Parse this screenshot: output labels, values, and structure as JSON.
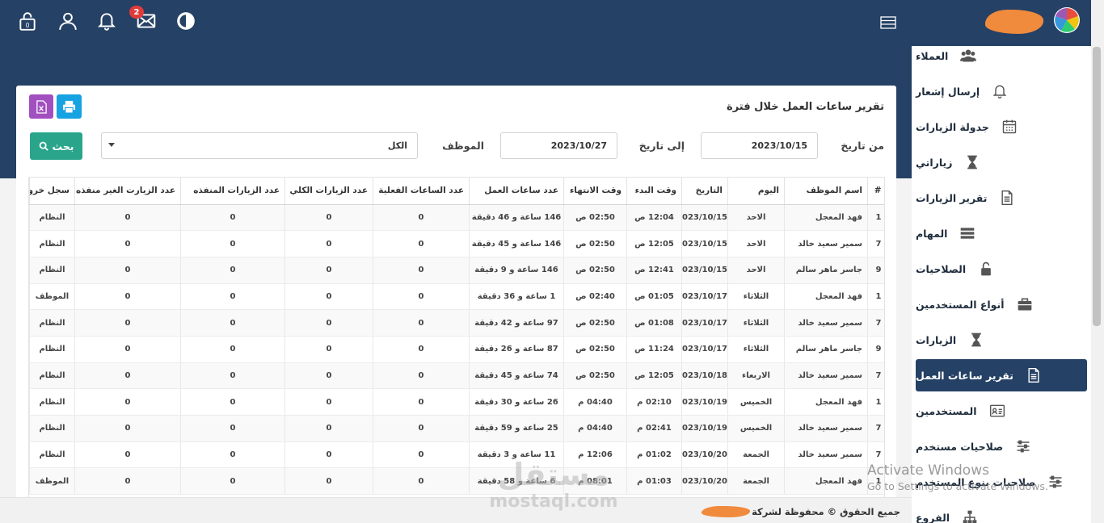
{
  "header": {
    "notification_count": "2"
  },
  "sidebar": {
    "items": [
      {
        "label": "العملاء",
        "icon": "users-icon"
      },
      {
        "label": "إرسال إشعار",
        "icon": "bell-icon"
      },
      {
        "label": "جدولة الزيارات",
        "icon": "calendar-icon"
      },
      {
        "label": "زياراتي",
        "icon": "hourglass-icon"
      },
      {
        "label": "تقرير الزيارات",
        "icon": "document-icon"
      },
      {
        "label": "المهام",
        "icon": "tasks-icon"
      },
      {
        "label": "الصلاحيات",
        "icon": "unlock-icon"
      },
      {
        "label": "أنواع المستخدمين",
        "icon": "briefcase-icon"
      },
      {
        "label": "الزيارات",
        "icon": "hourglass-icon"
      },
      {
        "label": "تقرير ساعات العمل",
        "icon": "document-icon"
      },
      {
        "label": "المستخدمين",
        "icon": "id-card-icon"
      },
      {
        "label": "صلاحيات مستخدم",
        "icon": "sliders-icon"
      },
      {
        "label": "صلاحيات بنوع المستخدم",
        "icon": "sliders-icon"
      },
      {
        "label": "الفروع",
        "icon": "sitemap-icon"
      }
    ],
    "active_index": 9
  },
  "report": {
    "title": "تقرير ساعات العمل خلال فترة",
    "from_label": "من تاريخ",
    "from_value": "2023/10/15",
    "to_label": "إلى تاريخ",
    "to_value": "2023/10/27",
    "employee_label": "الموظف",
    "employee_value": "الكل",
    "search_label": "بحث"
  },
  "table": {
    "headers": [
      "#",
      "اسم الموظف",
      "اليوم",
      "التاريخ",
      "وقت البدء",
      "وقت الانتهاء",
      "عدد ساعات العمل",
      "عدد الساعات الفعلية",
      "عدد الزيارات الكلي",
      "عدد الزيارات المنفذه",
      "عدد الزيارت الغير منفذه",
      "سجل خروج"
    ],
    "rows": [
      [
        "1",
        "فهد المعجل",
        "الاحد",
        "2023/10/15",
        "12:04 ص",
        "02:50 ص",
        "146 ساعة و 46 دقيقة",
        "0",
        "0",
        "0",
        "0",
        "النظام"
      ],
      [
        "7",
        "سمير سعيد خالد",
        "الاحد",
        "2023/10/15",
        "12:05 ص",
        "02:50 ص",
        "146 ساعة و 45 دقيقة",
        "0",
        "0",
        "0",
        "0",
        "النظام"
      ],
      [
        "9",
        "جاسر ماهر سالم",
        "الاحد",
        "2023/10/15",
        "12:41 ص",
        "02:50 ص",
        "146 ساعة و 9 دقيقة",
        "0",
        "0",
        "0",
        "0",
        "النظام"
      ],
      [
        "1",
        "فهد المعجل",
        "الثلاثاء",
        "2023/10/17",
        "01:05 ص",
        "02:40 ص",
        "1 ساعة و 36 دقيقة",
        "0",
        "0",
        "0",
        "0",
        "الموظف"
      ],
      [
        "7",
        "سمير سعيد خالد",
        "الثلاثاء",
        "2023/10/17",
        "01:08 ص",
        "02:50 ص",
        "97 ساعة و 42 دقيقة",
        "0",
        "0",
        "0",
        "0",
        "النظام"
      ],
      [
        "9",
        "جاسر ماهر سالم",
        "الثلاثاء",
        "2023/10/17",
        "11:24 ص",
        "02:50 ص",
        "87 ساعة و 26 دقيقة",
        "0",
        "0",
        "0",
        "0",
        "النظام"
      ],
      [
        "7",
        "سمير سعيد خالد",
        "الاربعاء",
        "2023/10/18",
        "12:05 ص",
        "02:50 ص",
        "74 ساعة و 45 دقيقة",
        "0",
        "0",
        "0",
        "0",
        "النظام"
      ],
      [
        "1",
        "فهد المعجل",
        "الخميس",
        "2023/10/19",
        "02:10 م",
        "04:40 م",
        "26 ساعة و 30 دقيقة",
        "0",
        "0",
        "0",
        "0",
        "النظام"
      ],
      [
        "7",
        "سمير سعيد خالد",
        "الخميس",
        "2023/10/19",
        "02:41 م",
        "04:40 م",
        "25 ساعة و 59 دقيقة",
        "0",
        "0",
        "0",
        "0",
        "النظام"
      ],
      [
        "7",
        "سمير سعيد خالد",
        "الجمعة",
        "2023/10/20",
        "01:02 م",
        "12:06 م",
        "11 ساعة و 3 دقيقة",
        "0",
        "0",
        "0",
        "0",
        "النظام"
      ],
      [
        "1",
        "فهد المعجل",
        "الجمعة",
        "2023/10/20",
        "01:03 م",
        "08:01 م",
        "6 ساعة و 58 دقيقة",
        "0",
        "0",
        "0",
        "0",
        "الموظف"
      ]
    ]
  },
  "footer": {
    "text": "جميع الحقوق © محفوظة لشركة"
  },
  "watermark": {
    "arabic": "مستقل",
    "latin": "mostaql.com"
  },
  "os_overlay": {
    "line1": "Activate Windows",
    "line2": "Go to Settings to activate Windows."
  },
  "colors": {
    "header_bg": "#254165",
    "active_item": "#254165",
    "search_btn": "#2aa58c",
    "excel_btn": "#a24fbf",
    "print_btn": "#17a2e2",
    "badge": "#e03b3b"
  }
}
